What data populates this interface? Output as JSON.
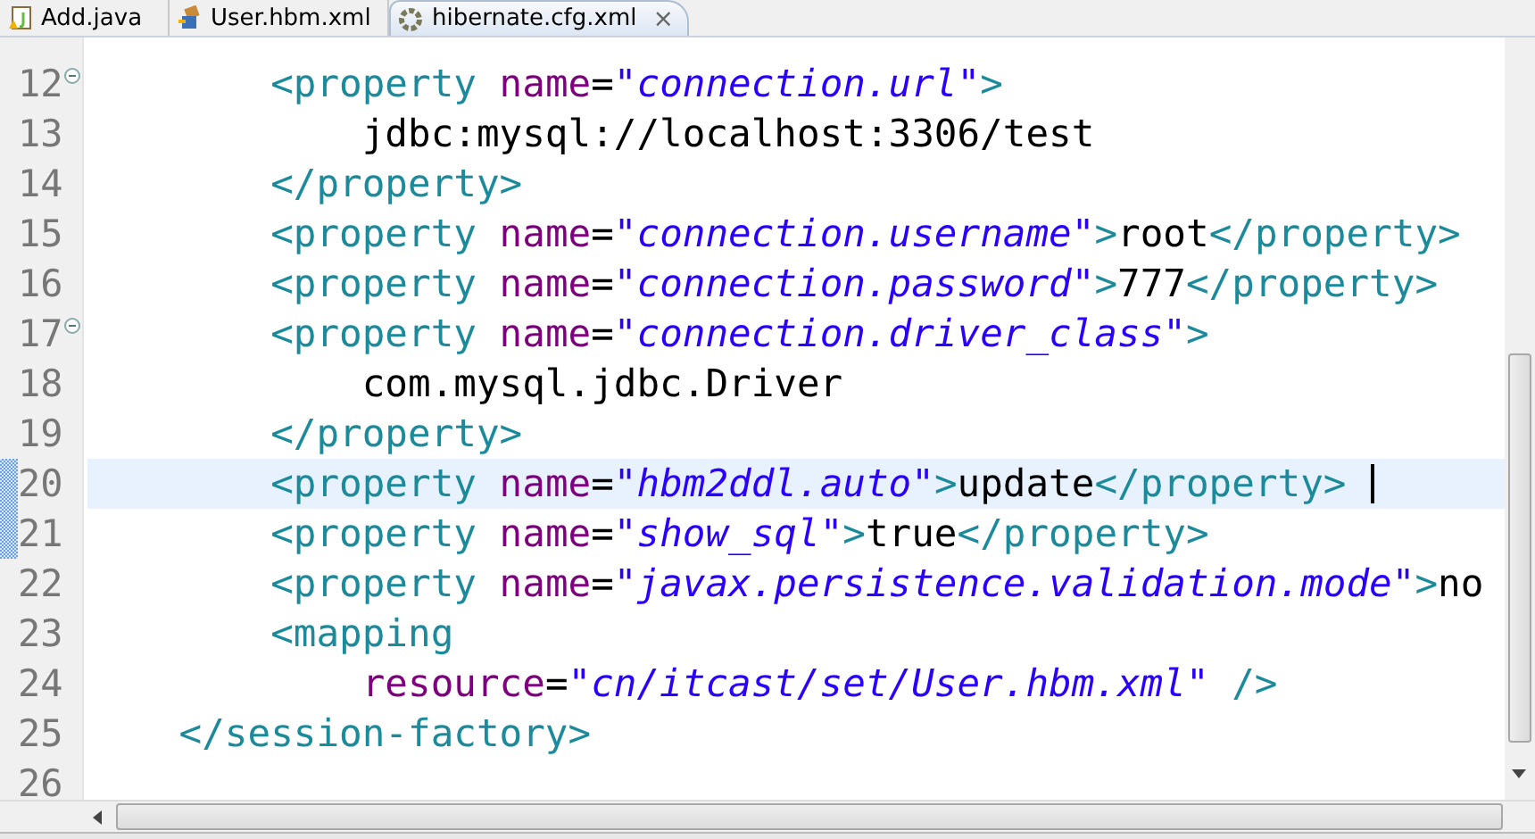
{
  "tabs": [
    {
      "label": "Add.java",
      "selected": false,
      "kind": "java"
    },
    {
      "label": "User.hbm.xml",
      "selected": false,
      "kind": "mapping"
    },
    {
      "label": "hibernate.cfg.xml",
      "selected": true,
      "kind": "config",
      "close": "⨯"
    }
  ],
  "editor": {
    "lines": [
      {
        "number": "12",
        "current": false,
        "changed": false,
        "foldable": true,
        "segments": [
          {
            "kind": "tag",
            "text": "        <property "
          },
          {
            "kind": "attr",
            "text": "name"
          },
          {
            "kind": "text",
            "text": "="
          },
          {
            "kind": "value",
            "text": "\"connection.url\""
          },
          {
            "kind": "tag",
            "text": ">"
          }
        ]
      },
      {
        "number": "13",
        "current": false,
        "changed": false,
        "foldable": false,
        "segments": [
          {
            "kind": "text",
            "text": "            jdbc:mysql://localhost:3306/test"
          }
        ]
      },
      {
        "number": "14",
        "current": false,
        "changed": false,
        "foldable": false,
        "segments": [
          {
            "kind": "tag",
            "text": "        </property>"
          }
        ]
      },
      {
        "number": "15",
        "current": false,
        "changed": false,
        "foldable": false,
        "segments": [
          {
            "kind": "tag",
            "text": "        <property "
          },
          {
            "kind": "attr",
            "text": "name"
          },
          {
            "kind": "text",
            "text": "="
          },
          {
            "kind": "value",
            "text": "\"connection.username\""
          },
          {
            "kind": "tag",
            "text": ">"
          },
          {
            "kind": "text",
            "text": "root"
          },
          {
            "kind": "tag",
            "text": "</property>"
          }
        ]
      },
      {
        "number": "16",
        "current": false,
        "changed": false,
        "foldable": false,
        "segments": [
          {
            "kind": "tag",
            "text": "        <property "
          },
          {
            "kind": "attr",
            "text": "name"
          },
          {
            "kind": "text",
            "text": "="
          },
          {
            "kind": "value",
            "text": "\"connection.password\""
          },
          {
            "kind": "tag",
            "text": ">"
          },
          {
            "kind": "text",
            "text": "777"
          },
          {
            "kind": "tag",
            "text": "</property>"
          }
        ]
      },
      {
        "number": "17",
        "current": false,
        "changed": false,
        "foldable": true,
        "segments": [
          {
            "kind": "tag",
            "text": "        <property "
          },
          {
            "kind": "attr",
            "text": "name"
          },
          {
            "kind": "text",
            "text": "="
          },
          {
            "kind": "value",
            "text": "\"connection.driver_class\""
          },
          {
            "kind": "tag",
            "text": ">"
          }
        ]
      },
      {
        "number": "18",
        "current": false,
        "changed": false,
        "foldable": false,
        "segments": [
          {
            "kind": "text",
            "text": "            com.mysql.jdbc.Driver"
          }
        ]
      },
      {
        "number": "19",
        "current": false,
        "changed": false,
        "foldable": false,
        "segments": [
          {
            "kind": "tag",
            "text": "        </property>"
          }
        ]
      },
      {
        "number": "20",
        "current": true,
        "changed": true,
        "foldable": false,
        "segments": [
          {
            "kind": "tag",
            "text": "        <property "
          },
          {
            "kind": "attr",
            "text": "name"
          },
          {
            "kind": "text",
            "text": "="
          },
          {
            "kind": "value",
            "text": "\"hbm2ddl.auto\""
          },
          {
            "kind": "tag",
            "text": ">"
          },
          {
            "kind": "text",
            "text": "update"
          },
          {
            "kind": "tag",
            "text": "</property>"
          }
        ]
      },
      {
        "number": "21",
        "current": false,
        "changed": true,
        "foldable": false,
        "segments": [
          {
            "kind": "tag",
            "text": "        <property "
          },
          {
            "kind": "attr",
            "text": "name"
          },
          {
            "kind": "text",
            "text": "="
          },
          {
            "kind": "value",
            "text": "\"show_sql\""
          },
          {
            "kind": "tag",
            "text": ">"
          },
          {
            "kind": "text",
            "text": "true"
          },
          {
            "kind": "tag",
            "text": "</property>"
          }
        ]
      },
      {
        "number": "22",
        "current": false,
        "changed": false,
        "foldable": false,
        "segments": [
          {
            "kind": "tag",
            "text": "        <property "
          },
          {
            "kind": "attr",
            "text": "name"
          },
          {
            "kind": "text",
            "text": "="
          },
          {
            "kind": "value",
            "text": "\"javax.persistence.validation.mode\""
          },
          {
            "kind": "tag",
            "text": ">"
          },
          {
            "kind": "text",
            "text": "no"
          }
        ]
      },
      {
        "number": "23",
        "current": false,
        "changed": false,
        "foldable": false,
        "segments": [
          {
            "kind": "tag",
            "text": "        <mapping"
          }
        ]
      },
      {
        "number": "24",
        "current": false,
        "changed": false,
        "foldable": false,
        "segments": [
          {
            "kind": "attr",
            "text": "            resource"
          },
          {
            "kind": "text",
            "text": "="
          },
          {
            "kind": "value",
            "text": "\"cn/itcast/set/User.hbm.xml\""
          },
          {
            "kind": "tag",
            "text": " />"
          }
        ]
      },
      {
        "number": "25",
        "current": false,
        "changed": false,
        "foldable": false,
        "segments": [
          {
            "kind": "tag",
            "text": "    </session-factory>"
          }
        ]
      },
      {
        "number": "26",
        "current": false,
        "changed": false,
        "foldable": false
      }
    ]
  }
}
